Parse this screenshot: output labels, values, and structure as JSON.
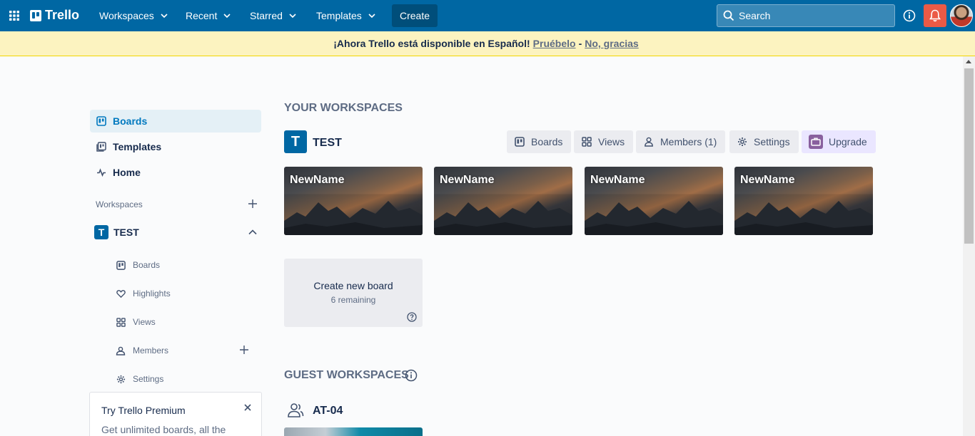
{
  "header": {
    "logo_text": "Trello",
    "nav": [
      {
        "label": "Workspaces"
      },
      {
        "label": "Recent"
      },
      {
        "label": "Starred"
      },
      {
        "label": "Templates"
      }
    ],
    "create_label": "Create",
    "search_placeholder": "Search",
    "brand_color": "#0067a3"
  },
  "banner": {
    "text": "¡Ahora Trello está disponible en Español!",
    "try_link": "Pruébelo",
    "separator": "-",
    "dismiss_link": "No, gracias"
  },
  "sidebar": {
    "items": [
      {
        "label": "Boards",
        "icon": "board-icon",
        "active": true
      },
      {
        "label": "Templates",
        "icon": "template-icon"
      },
      {
        "label": "Home",
        "icon": "activity-icon"
      }
    ],
    "workspaces_label": "Workspaces",
    "workspace": {
      "initial": "T",
      "name": "TEST",
      "sub_items": [
        {
          "label": "Boards",
          "icon": "board-icon"
        },
        {
          "label": "Highlights",
          "icon": "heart-icon"
        },
        {
          "label": "Views",
          "icon": "grid-icon"
        },
        {
          "label": "Members",
          "icon": "members-icon"
        },
        {
          "label": "Settings",
          "icon": "gear-icon"
        }
      ]
    },
    "premium": {
      "title": "Try Trello Premium",
      "body": "Get unlimited boards, all the"
    }
  },
  "main": {
    "your_workspaces_title": "YOUR WORKSPACES",
    "workspace": {
      "initial": "T",
      "name": "TEST",
      "buttons": [
        {
          "label": "Boards",
          "icon": "board-icon"
        },
        {
          "label": "Views",
          "icon": "grid-icon"
        },
        {
          "label": "Members (1)",
          "icon": "person-icon"
        },
        {
          "label": "Settings",
          "icon": "gear-icon"
        },
        {
          "label": "Upgrade",
          "icon": "briefcase-icon"
        }
      ],
      "boards": [
        {
          "name": "NewName"
        },
        {
          "name": "NewName"
        },
        {
          "name": "NewName"
        },
        {
          "name": "NewName"
        }
      ],
      "create_board": {
        "title": "Create new board",
        "remaining": "6 remaining"
      }
    },
    "guest_workspaces_title": "GUEST WORKSPACES",
    "guest_workspace": {
      "name": "AT-04"
    }
  }
}
